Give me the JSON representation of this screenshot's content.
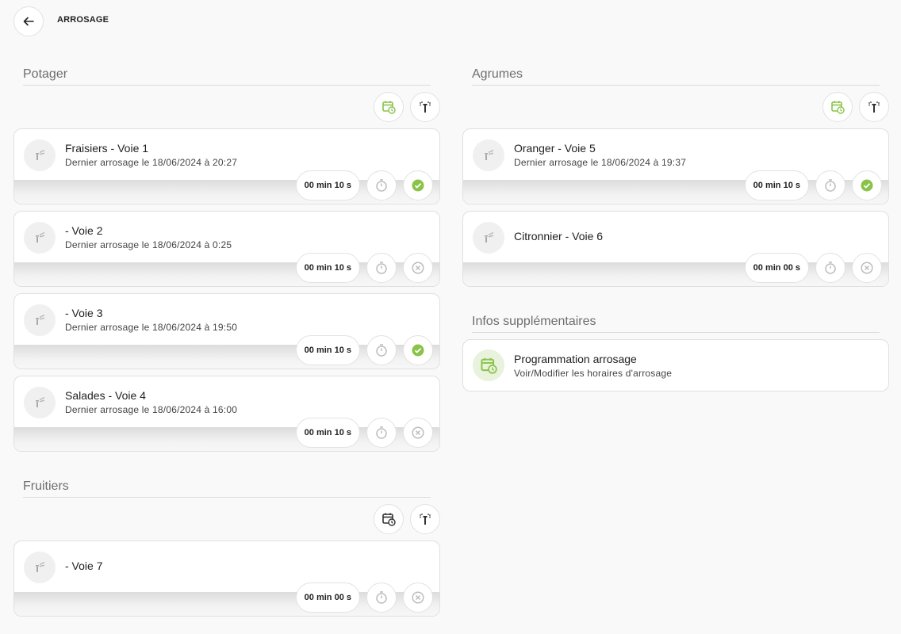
{
  "header": {
    "title": "ARROSAGE"
  },
  "colors": {
    "accent": "#8bc34a",
    "icon_gray": "#bdbdbd"
  },
  "sections": {
    "potager": {
      "title": "Potager",
      "zones": [
        {
          "name": "Fraisiers - Voie 1",
          "last": "Dernier arrosage le 18/06/2024 à 20:27",
          "duration": "00 min 10 s",
          "status": "check-icon"
        },
        {
          "name": "- Voie 2",
          "last": "Dernier arrosage le 18/06/2024 à 0:25",
          "duration": "00 min 10 s",
          "status": "cancel-icon"
        },
        {
          "name": "- Voie 3",
          "last": "Dernier arrosage le 18/06/2024 à 19:50",
          "duration": "00 min 10 s",
          "status": "check-icon"
        },
        {
          "name": "Salades - Voie 4",
          "last": "Dernier arrosage le 18/06/2024 à 16:00",
          "duration": "00 min 10 s",
          "status": "cancel-icon"
        }
      ]
    },
    "fruitiers": {
      "title": "Fruitiers",
      "zones": [
        {
          "name": "- Voie 7",
          "last": "",
          "duration": "00 min 00 s",
          "status": "cancel-icon"
        }
      ]
    },
    "agrumes": {
      "title": "Agrumes",
      "zones": [
        {
          "name": "Oranger - Voie 5",
          "last": "Dernier arrosage le 18/06/2024 à 19:37",
          "duration": "00 min 10 s",
          "status": "check-icon"
        },
        {
          "name": "Citronnier - Voie 6",
          "last": "",
          "duration": "00 min 00 s",
          "status": "cancel-icon"
        }
      ]
    },
    "infos": {
      "title": "Infos supplémentaires",
      "card": {
        "title": "Programmation arrosage",
        "subtitle": "Voir/Modifier les horaires d'arrosage"
      }
    }
  }
}
